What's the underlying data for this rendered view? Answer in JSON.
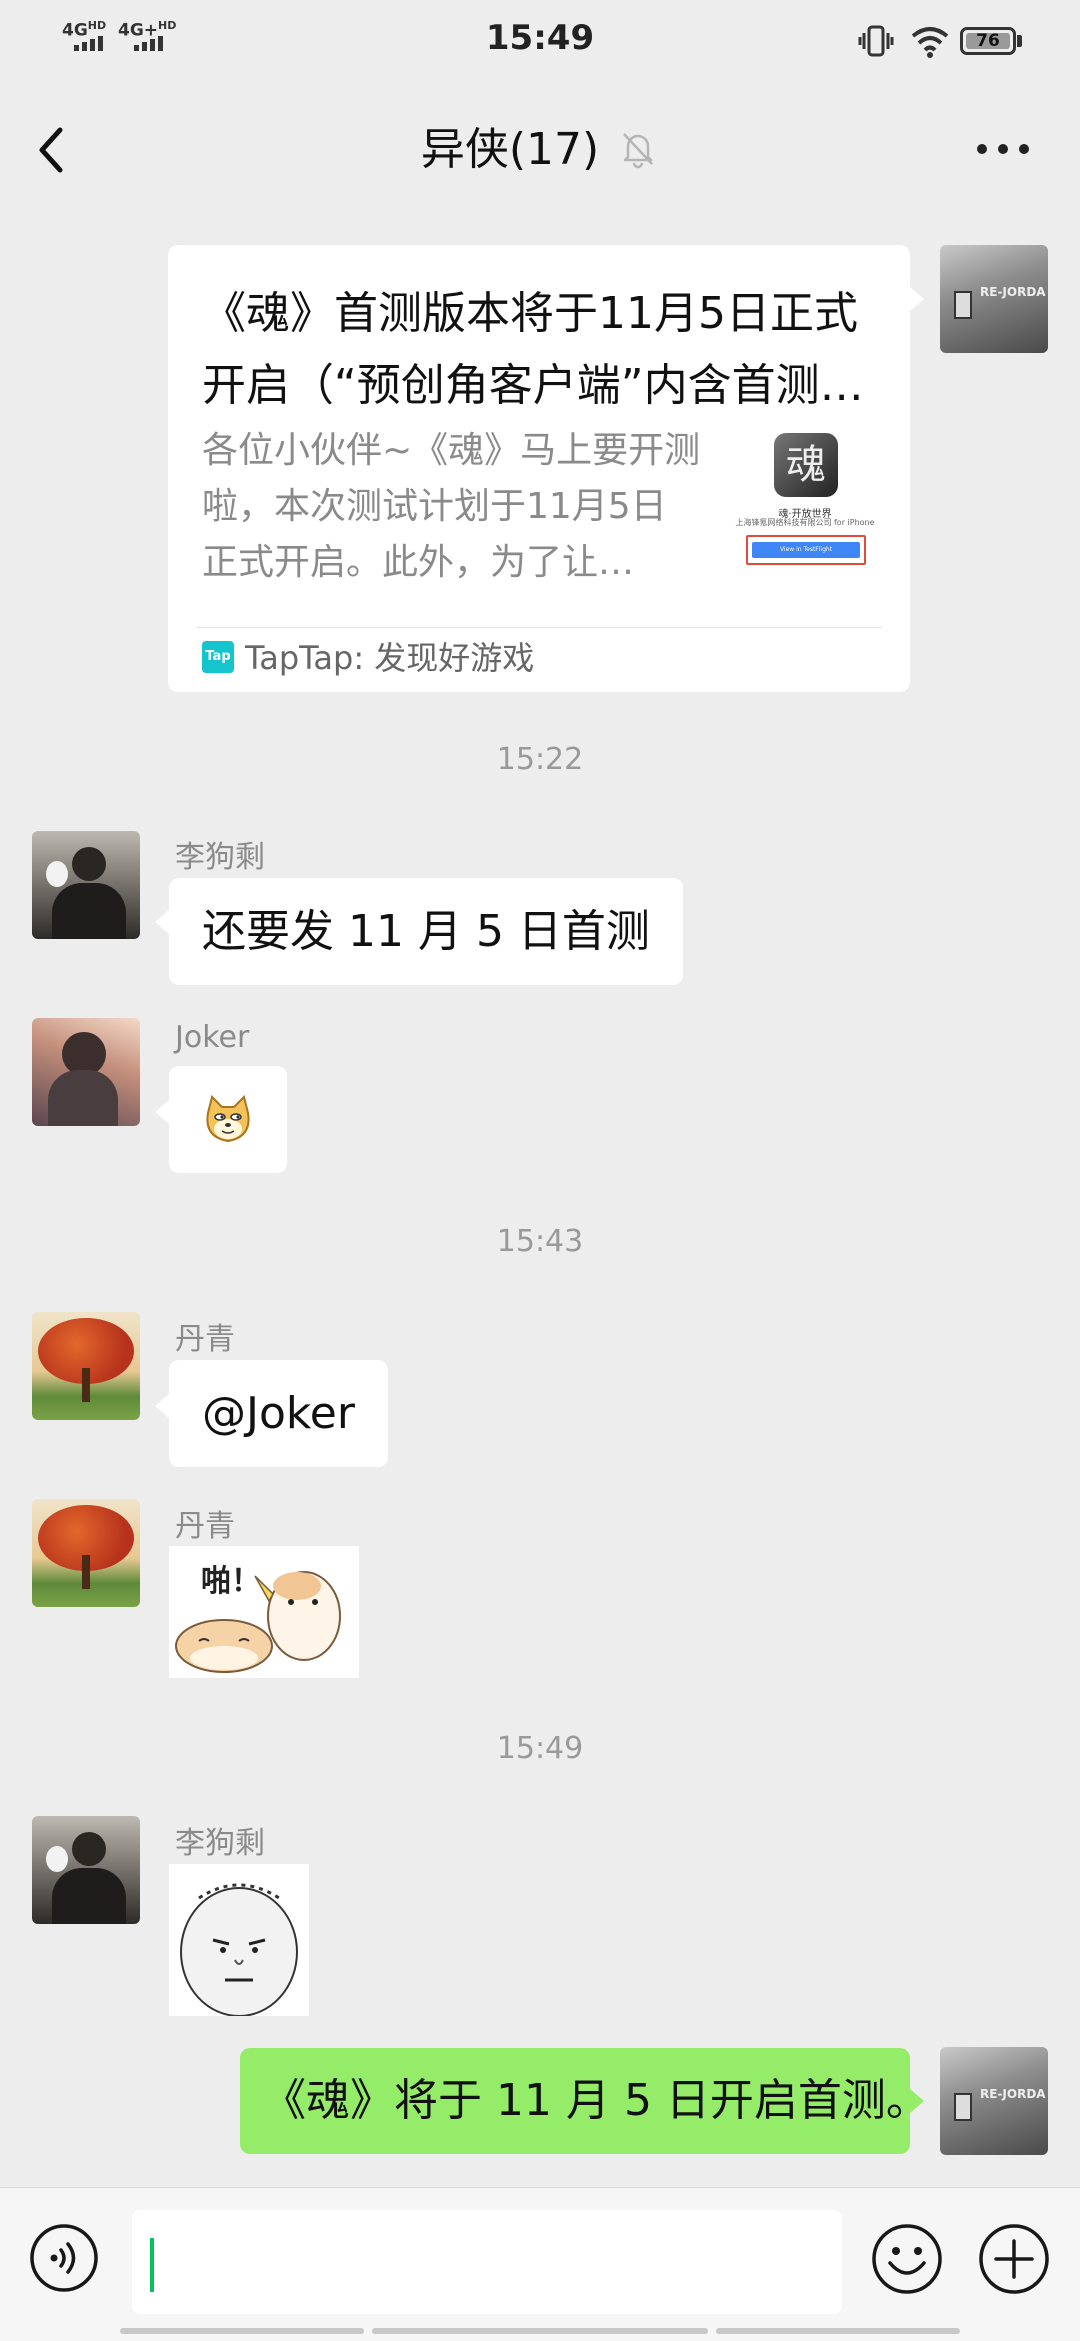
{
  "status_bar": {
    "net1": "4G",
    "net1_sup": "HD",
    "net2": "4G+",
    "net2_sup": "HD",
    "time": "15:49",
    "battery": "76"
  },
  "header": {
    "title": "异侠(17)"
  },
  "messages": {
    "link_card": {
      "title": "《魂》首测版本将于11月5日正式开启（“预创角客户端”内含首测…",
      "description": "各位小伙伴~《魂》马上要开测啦，本次测试计划于11月5日正式开启。此外，为了让…",
      "thumb_text": "魂·开放世界",
      "thumb_company": "上海锋氪网络科技有限公司 for iPhone",
      "thumb_button": "View in TestFlight",
      "source_icon": "Tap",
      "source": "TapTap: 发现好游戏"
    },
    "time1": "15:22",
    "msg1": {
      "sender": "李狗剩",
      "text": "还要发 11 月 5 日首测"
    },
    "msg2": {
      "sender": "Joker",
      "sticker": "doge-emoji"
    },
    "time2": "15:43",
    "msg3": {
      "sender": "丹青",
      "text": "@Joker"
    },
    "msg4": {
      "sender": "丹青",
      "sticker_text": "啪！"
    },
    "time3": "15:49",
    "msg5": {
      "sender": "李狗剩",
      "sticker": "meme-face"
    },
    "msg6": {
      "text": "《魂》将于 11 月 5 日开启首测。"
    }
  },
  "input_bar": {
    "placeholder": "",
    "icons": [
      "voice-icon",
      "emoji-icon",
      "plus-icon"
    ]
  },
  "colors": {
    "background": "#ededed",
    "self_bubble": "#95ec69",
    "caret": "#07c160",
    "taptap": "#15c5ce"
  }
}
